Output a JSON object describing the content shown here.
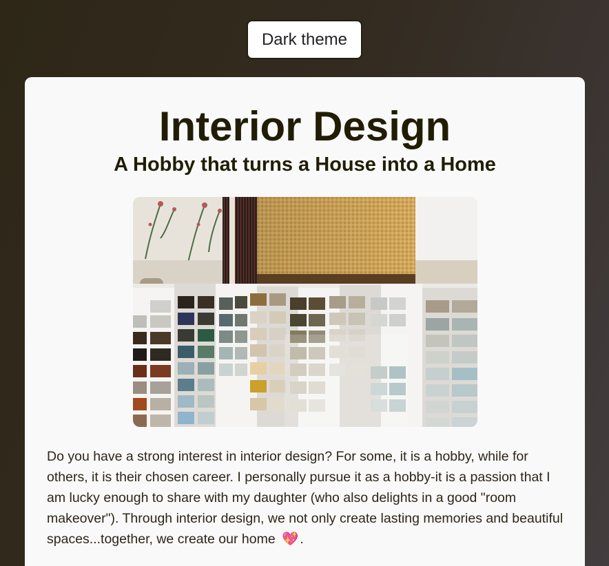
{
  "theme_button": {
    "label": "Dark theme"
  },
  "header": {
    "title": "Interior Design",
    "subtitle": "A Hobby that turns a House into a Home"
  },
  "image": {
    "alt": "Fabric swatches and paint color sample strips"
  },
  "body": {
    "paragraph": "Do you have a strong interest in interior design? For some, it is a hobby, while for others, it is their chosen career. I personally pursue it as a hobby-it is a passion that I am lucky enough to share with my daughter (who also delights in a good \"room makeover\"). Through interior design, we not only create lasting memories and beautiful spaces...together, we create our home",
    "emoji": "💖",
    "end_punct": "."
  },
  "colors": {
    "background_dark": "#2e2718",
    "card": "#f9f9f9",
    "heading": "#211d05",
    "text": "#2c2618"
  }
}
